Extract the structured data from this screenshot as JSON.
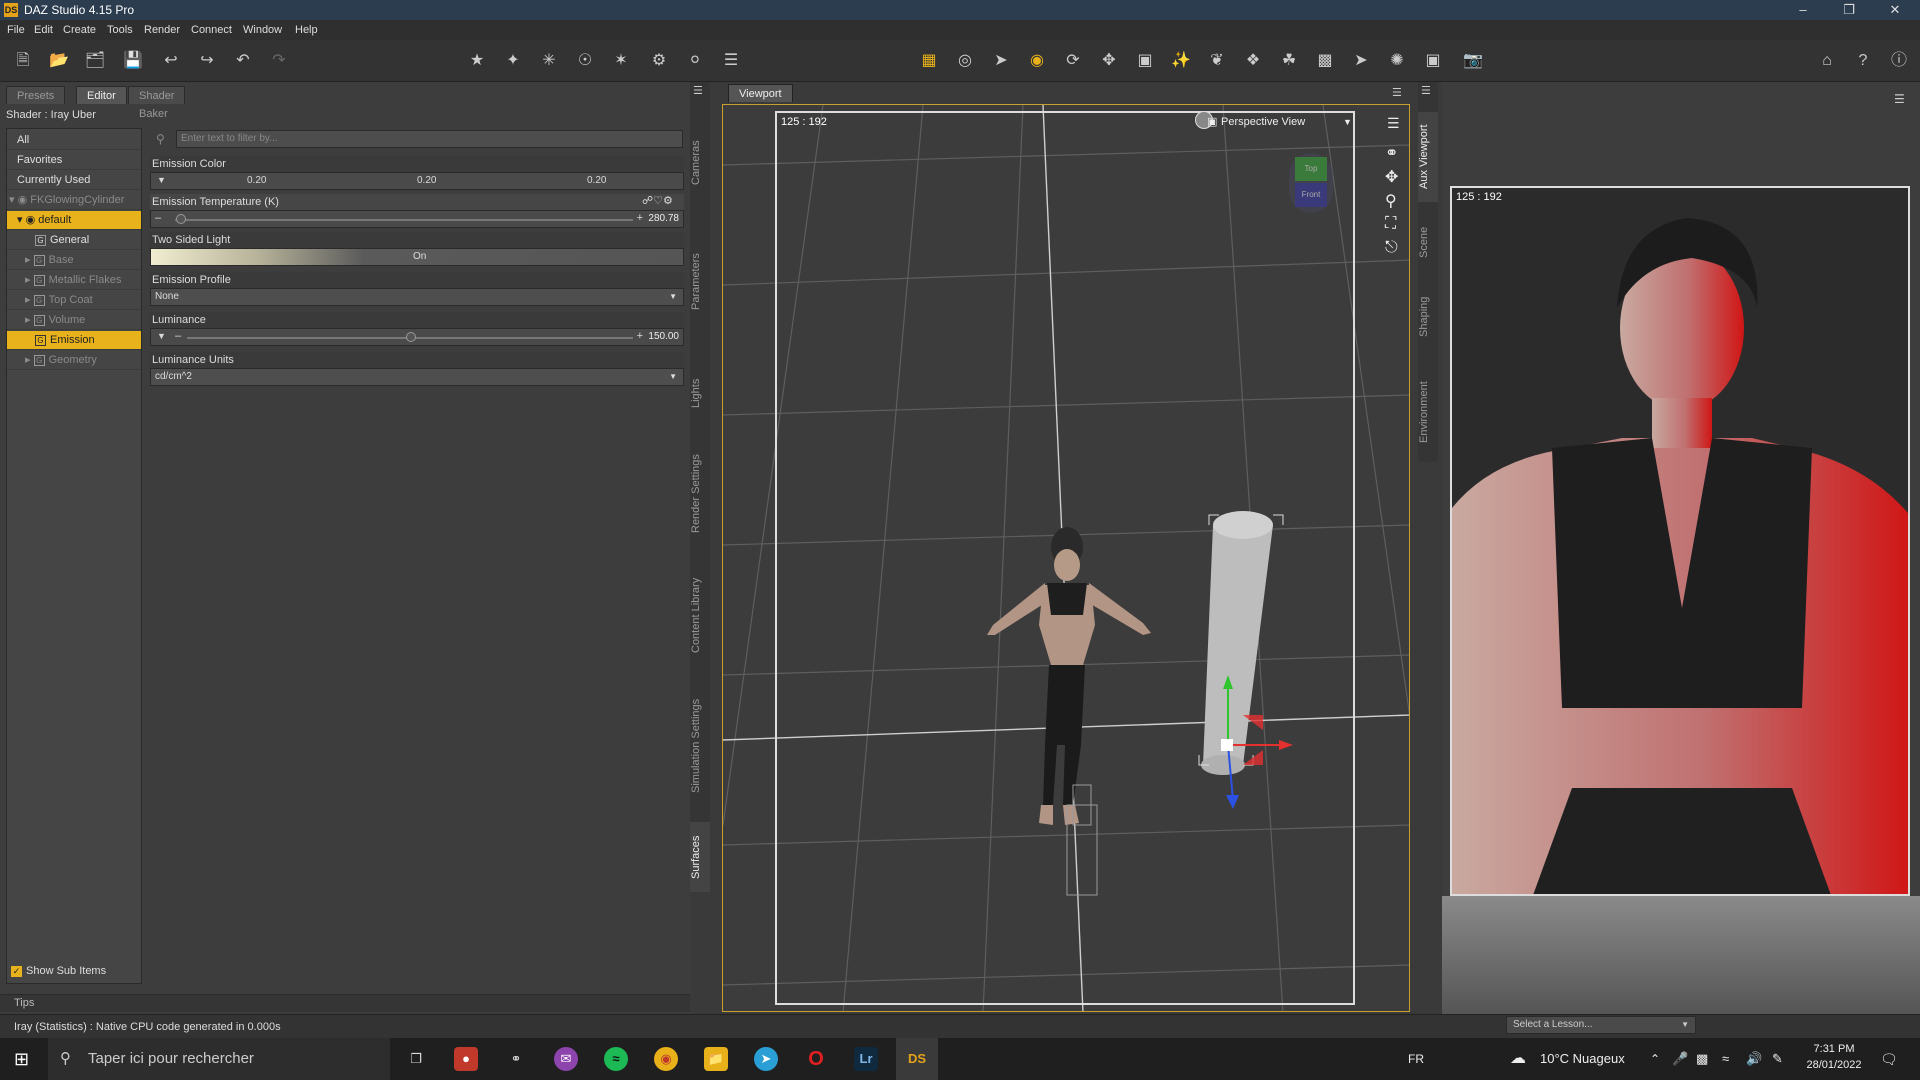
{
  "app": {
    "title": "DAZ Studio 4.15 Pro",
    "logo": "DS"
  },
  "menu": [
    "File",
    "Edit",
    "Create",
    "Tools",
    "Render",
    "Connect",
    "Window",
    "Help"
  ],
  "left_panel": {
    "tabs": [
      "Presets",
      "Editor",
      "Shader Baker"
    ],
    "shader_label": "Shader : Iray Uber",
    "filter_placeholder": "Enter text to filter by...",
    "tree": {
      "all": "All",
      "favorites": "Favorites",
      "currently_used": "Currently Used",
      "node": "FKGlowingCylinder",
      "default": "default",
      "items": [
        "General",
        "Base",
        "Metallic Flakes",
        "Top Coat",
        "Volume",
        "Emission",
        "Geometry"
      ]
    },
    "props": {
      "emission_color_label": "Emission Color",
      "emission_color_values": [
        "0.20",
        "0.20",
        "0.20"
      ],
      "emission_temp_label": "Emission Temperature (K)",
      "emission_temp_value": "280.78",
      "emission_temp_fraction": 0.01,
      "two_sided_label": "Two Sided Light",
      "two_sided_value": "On",
      "emission_profile_label": "Emission Profile",
      "emission_profile_value": "None",
      "luminance_label": "Luminance",
      "luminance_value": "150.00",
      "luminance_fraction": 0.5,
      "luminance_units_label": "Luminance Units",
      "luminance_units_value": "cd/cm^2"
    },
    "show_sub_items": "Show Sub Items",
    "tips": "Tips"
  },
  "side_tabs_left": [
    "Cameras",
    "Parameters",
    "Lights",
    "Render Settings",
    "Content Library",
    "Simulation Settings",
    "Surfaces"
  ],
  "side_tabs_right": [
    "Aux Viewport",
    "Scene",
    "Shaping",
    "Environment"
  ],
  "viewport": {
    "tab": "Viewport",
    "ratio": "125 : 192",
    "view": "Perspective View",
    "cube_top": "Top",
    "cube_front": "Front"
  },
  "aux": {
    "ratio": "125 : 192",
    "lesson": "Select a Lesson..."
  },
  "status": {
    "message": "Iray (Statistics) : Native CPU code generated in 0.000s"
  },
  "taskbar": {
    "search": "Taper ici pour rechercher",
    "lang": "FR",
    "weather": "10°C  Nuageux",
    "time": "7:31 PM",
    "date": "28/01/2022"
  }
}
